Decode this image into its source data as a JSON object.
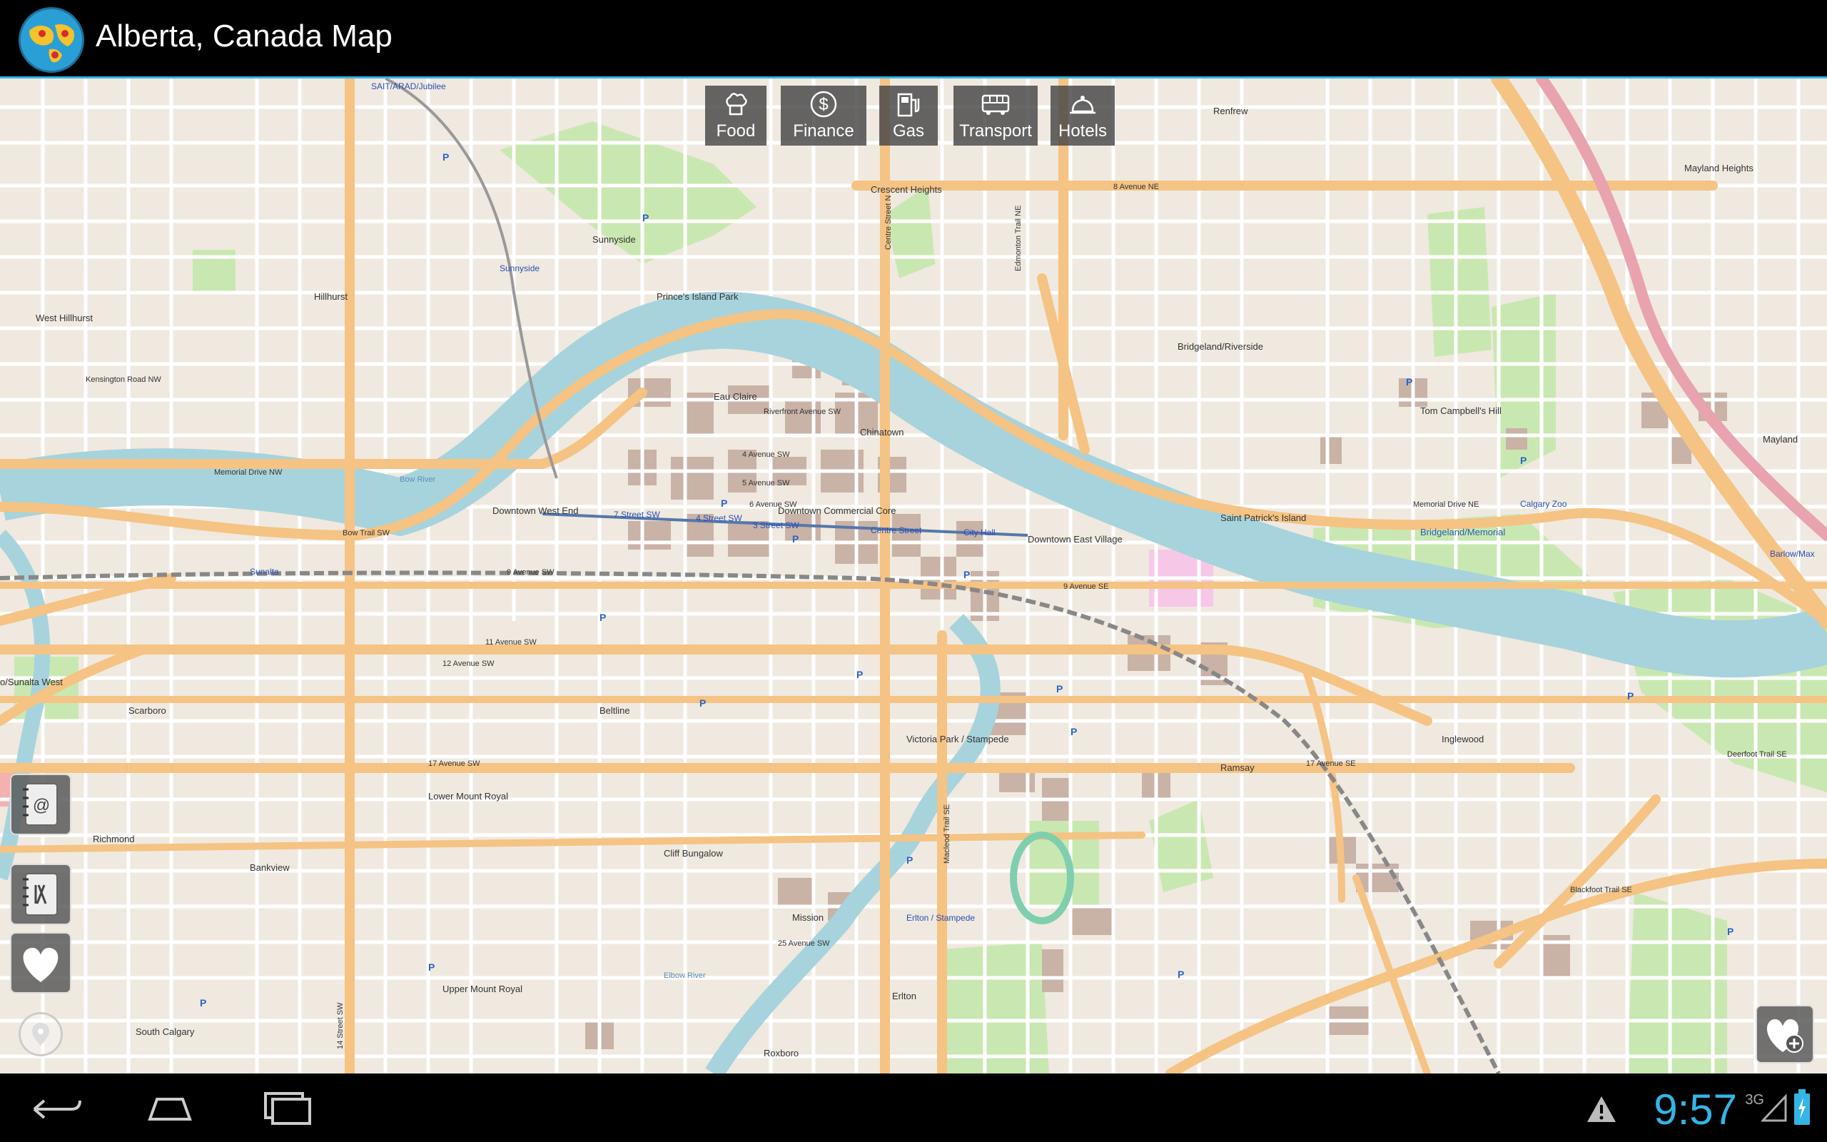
{
  "app": {
    "title": "Alberta, Canada Map"
  },
  "categories": [
    {
      "label": "Food",
      "icon": "chef-hat-icon"
    },
    {
      "label": "Finance",
      "icon": "dollar-icon"
    },
    {
      "label": "Gas",
      "icon": "gas-pump-icon"
    },
    {
      "label": "Transport",
      "icon": "bus-icon"
    },
    {
      "label": "Hotels",
      "icon": "bell-icon"
    }
  ],
  "map": {
    "labels": {
      "sunnyside": "Sunnyside",
      "hillhurst": "Hillhurst",
      "west_hillhurst": "West Hillhurst",
      "crescent_heights": "Crescent Heights",
      "renfrew": "Renfrew",
      "mayland_heights": "Mayland Heights",
      "bridgeland": "Bridgeland/Riverside",
      "eau_claire": "Eau Claire",
      "chinatown": "Chinatown",
      "downtown_west_end": "Downtown West End",
      "downtown_commercial": "Downtown Commercial Core",
      "downtown_east_village": "Downtown East Village",
      "st_patricks": "Saint Patrick's Island",
      "mayland": "Mayland",
      "tom_campbell": "Tom Campbell's Hill",
      "scarboro": "Scarboro",
      "sunalta_west": "o/Sunalta West",
      "beltline": "Beltline",
      "victoria_park": "Victoria Park / Stampede",
      "inglewood": "Inglewood",
      "ramsay": "Ramsay",
      "richmond": "Richmond",
      "bankview": "Bankview",
      "lower_mount_royal": "Lower Mount Royal",
      "cliff_bungalow": "Cliff Bungalow",
      "mission": "Mission",
      "upper_mount_royal": "Upper Mount Royal",
      "south_calgary": "South Calgary",
      "roxboro": "Roxboro",
      "erlton": "Erlton",
      "erlton_stampede": "Erlton / Stampede",
      "bridgeland_memorial": "Bridgeland/Memorial",
      "calgary_zoo": "Calgary Zoo",
      "sait": "SAIT/ARAD/Jubilee",
      "sunnyside_station": "Sunnyside",
      "street_7": "7 Street SW",
      "street_4": "4 Street SW",
      "street_3": "3 Street SW",
      "centre_street": "Centre Street",
      "city_hall": "City Hall",
      "sunalta": "Sunalta",
      "barlow": "Barlow/Max",
      "memorial_dr_nw": "Memorial Drive NW",
      "memorial_dr_ne": "Memorial Drive NE",
      "ave_9": "9 Avenue SW",
      "ave_9se": "9 Avenue SE",
      "ave_17": "17 Avenue SW",
      "ave_17se": "17 Avenue SE",
      "ave_11": "11 Avenue SW",
      "ave_12": "12 Avenue SW",
      "ave_25": "25 Avenue SW",
      "ave_8ne": "8 Avenue NE",
      "kensington": "Kensington Road NW",
      "bow_trail": "Bow Trail SW",
      "deerfoot": "Deerfoot Trail SE",
      "blackfoot": "Blackfoot Trail SE",
      "street_14": "14 Street SW",
      "macleod": "Macleod Trail SE",
      "edmonton_trail": "Edmonton Trail NE",
      "centre_st_n": "Centre Street N",
      "ave_4": "4 Avenue SW",
      "ave_5": "5 Avenue SW",
      "ave_6": "6 Avenue SW",
      "riverfront": "Riverfront Avenue SW",
      "bow_river": "Bow River",
      "elbow_river": "Elbow River",
      "princes_island": "Prince's Island Park"
    }
  },
  "sidebar": [
    {
      "name": "contacts-book-icon"
    },
    {
      "name": "restaurant-book-icon"
    },
    {
      "name": "heart-icon"
    }
  ],
  "fav_add": {
    "icon": "heart-plus-icon"
  },
  "status": {
    "time": "9:57",
    "network": "3G"
  },
  "colors": {
    "accent": "#33b5e5",
    "map_bg": "#efe9e0",
    "major_road": "#f7c489",
    "river": "#a7d3dc",
    "park": "#c9e8b1"
  }
}
